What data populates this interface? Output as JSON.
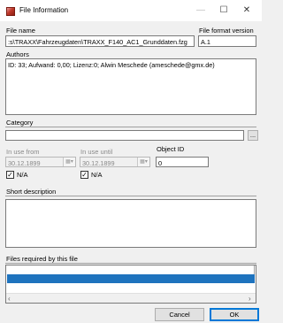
{
  "window": {
    "title": "File Information",
    "minimize": "—",
    "maximize": "☐",
    "close": "✕"
  },
  "file_name": {
    "label": "File name",
    "value": ":s\\TRAXX\\Fahrzeugdaten\\TRAXX_F140_AC1_Grunddaten.fzg"
  },
  "file_format": {
    "label": "File format version",
    "value": "A.1"
  },
  "authors": {
    "label": "Authors",
    "value": "ID: 33; Aufwand: 0,00; Lizenz:0; Alwin Meschede (ameschede@gmx.de)"
  },
  "category": {
    "label": "Category",
    "value": "",
    "browse": "..."
  },
  "in_use_from": {
    "label": "In use from",
    "date": "30.12.1899",
    "na_label": "N/A",
    "na_checked": true
  },
  "in_use_until": {
    "label": "In use until",
    "date": "30.12.1899",
    "na_label": "N/A",
    "na_checked": true
  },
  "object_id": {
    "label": "Object ID",
    "value": "0"
  },
  "short_description": {
    "label": "Short description",
    "value": ""
  },
  "files_required": {
    "label": "Files required by this file",
    "selected_row_color": "#1e73be"
  },
  "buttons": {
    "cancel": "Cancel",
    "ok": "OK"
  },
  "colors": {
    "accent": "#0078d7",
    "selection": "#1e73be"
  }
}
